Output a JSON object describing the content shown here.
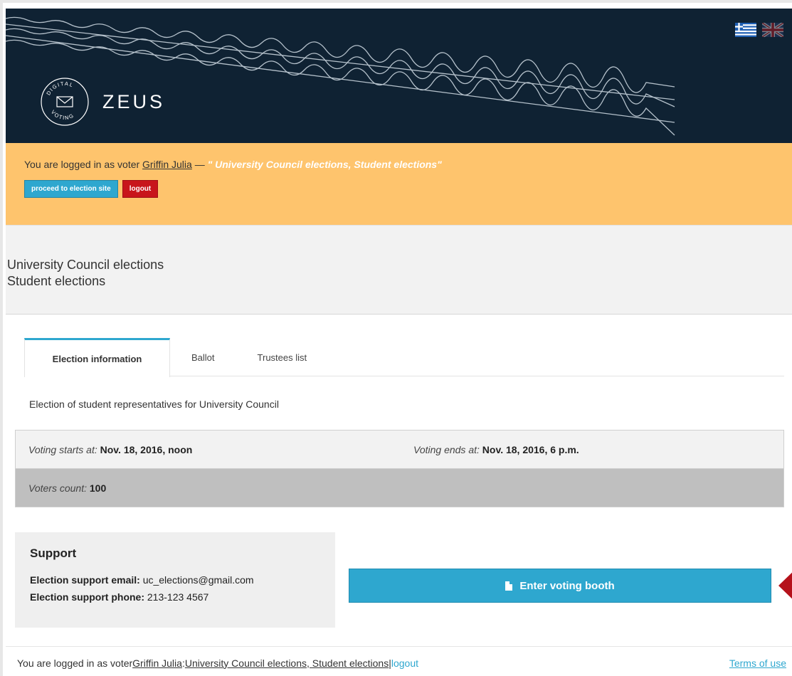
{
  "header": {
    "logo_badge_top": "DIGITAL",
    "logo_badge_bottom": "VOTING",
    "logo_text": "ZEUS",
    "flags": [
      "greek-flag-icon",
      "uk-flag-icon"
    ]
  },
  "login_bar": {
    "prefix": "You are logged in as voter ",
    "voter_name": "Griffin Julia",
    "separator": " — ",
    "elections": "\" University Council elections, Student elections\"",
    "proceed_label": "proceed to election site",
    "logout_label": "logout"
  },
  "title": {
    "line1": "University Council elections",
    "line2": "Student elections"
  },
  "tabs": [
    {
      "label": "Election information",
      "active": true
    },
    {
      "label": "Ballot",
      "active": false
    },
    {
      "label": "Trustees list",
      "active": false
    }
  ],
  "description": "Election of student representatives for University Council",
  "info": {
    "start_label": "Voting starts at:",
    "start_value": "Nov. 18, 2016, noon",
    "end_label": "Voting ends at:",
    "end_value": "Nov. 18, 2016, 6 p.m.",
    "count_label": "Voters count:",
    "count_value": "100"
  },
  "support": {
    "heading": "Support",
    "email_label": "Election support email:",
    "email_value": "uc_elections@gmail.com",
    "phone_label": "Election support phone:",
    "phone_value": "213-123 4567"
  },
  "booth_button": {
    "label": "Enter voting booth",
    "icon": "document-icon"
  },
  "footer": {
    "prefix": "You are logged in as voter ",
    "voter_name": "Griffin Julia",
    "colon": ": ",
    "elections": "University Council elections, Student elections",
    "pipe": " | ",
    "logout": "logout",
    "terms": "Terms of use"
  },
  "colors": {
    "header_bg": "#0f2233",
    "login_bar_bg": "#fec46d",
    "accent_blue": "#2ea7cf",
    "logout_red": "#c8151b",
    "arrow_red": "#b5121b"
  }
}
